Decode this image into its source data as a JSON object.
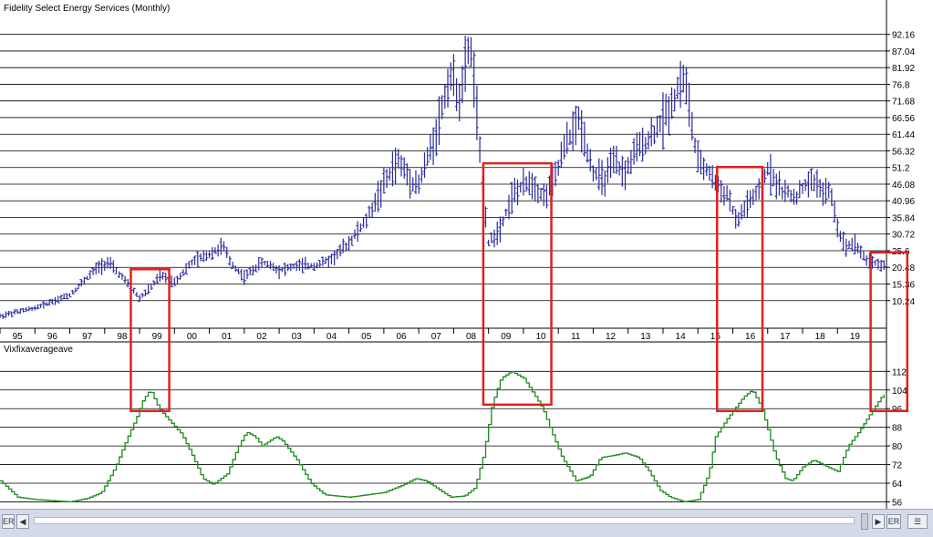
{
  "chart_data": [
    {
      "type": "ohlc",
      "title": "Fidelity Select Energy Services (Monthly)",
      "ylim": [
        4,
        96
      ],
      "y_ticks": [
        "92.16",
        "87.04",
        "81.92",
        "76.8",
        "71.68",
        "66.56",
        "61.44",
        "56.32",
        "51.2",
        "46.08",
        "40.96",
        "35.84",
        "30.72",
        "25.6",
        "20.48",
        "15.36",
        "10.24"
      ],
      "x_ticks": [
        "95",
        "96",
        "97",
        "98",
        "99",
        "00",
        "01",
        "02",
        "03",
        "04",
        "05",
        "06",
        "07",
        "08",
        "09",
        "10",
        "11",
        "12",
        "13",
        "14",
        "15",
        "16",
        "17",
        "18",
        "19"
      ],
      "x_range": [
        1995.0,
        2020.3
      ],
      "color": "#2b2a9c",
      "anchors": [
        [
          1995.0,
          5.5
        ],
        [
          1996.0,
          8.0
        ],
        [
          1997.0,
          12.0
        ],
        [
          1997.8,
          20.5
        ],
        [
          1998.1,
          22.0
        ],
        [
          1998.5,
          17.5
        ],
        [
          1999.0,
          11.0
        ],
        [
          1999.3,
          14.0
        ],
        [
          1999.6,
          18.0
        ],
        [
          2000.0,
          16.0
        ],
        [
          2000.5,
          22.0
        ],
        [
          2001.0,
          24.5
        ],
        [
          2001.4,
          27.0
        ],
        [
          2001.6,
          22.0
        ],
        [
          2002.0,
          17.5
        ],
        [
          2002.5,
          22.0
        ],
        [
          2002.8,
          21.0
        ],
        [
          2003.0,
          19.5
        ],
        [
          2003.5,
          21.0
        ],
        [
          2004.0,
          21.0
        ],
        [
          2004.5,
          23.0
        ],
        [
          2005.0,
          28.0
        ],
        [
          2005.5,
          35.0
        ],
        [
          2006.0,
          46.0
        ],
        [
          2006.4,
          53.5
        ],
        [
          2006.8,
          47.0
        ],
        [
          2007.0,
          46.0
        ],
        [
          2007.5,
          62.0
        ],
        [
          2007.9,
          80.0
        ],
        [
          2008.2,
          72.0
        ],
        [
          2008.45,
          90.0
        ],
        [
          2008.6,
          78.0
        ],
        [
          2008.75,
          55.0
        ],
        [
          2009.0,
          28.0
        ],
        [
          2009.3,
          32.0
        ],
        [
          2009.7,
          43.0
        ],
        [
          2010.2,
          47.0
        ],
        [
          2010.6,
          42.0
        ],
        [
          2010.9,
          48.0
        ],
        [
          2011.2,
          58.0
        ],
        [
          2011.6,
          66.0
        ],
        [
          2011.8,
          58.0
        ],
        [
          2012.0,
          50.0
        ],
        [
          2012.3,
          47.0
        ],
        [
          2012.6,
          53.0
        ],
        [
          2012.9,
          49.0
        ],
        [
          2013.2,
          56.0
        ],
        [
          2013.6,
          60.0
        ],
        [
          2014.0,
          66.0
        ],
        [
          2014.3,
          72.0
        ],
        [
          2014.55,
          79.0
        ],
        [
          2014.7,
          75.0
        ],
        [
          2014.85,
          62.0
        ],
        [
          2015.0,
          53.0
        ],
        [
          2015.3,
          50.0
        ],
        [
          2015.6,
          45.0
        ],
        [
          2015.9,
          42.0
        ],
        [
          2016.1,
          34.0
        ],
        [
          2016.4,
          40.0
        ],
        [
          2016.8,
          44.0
        ],
        [
          2017.0,
          51.0
        ],
        [
          2017.4,
          44.0
        ],
        [
          2017.8,
          42.0
        ],
        [
          2018.1,
          46.0
        ],
        [
          2018.4,
          47.0
        ],
        [
          2018.6,
          43.0
        ],
        [
          2018.8,
          44.0
        ],
        [
          2019.0,
          33.0
        ],
        [
          2019.2,
          27.0
        ],
        [
          2019.5,
          28.0
        ],
        [
          2019.8,
          23.0
        ],
        [
          2020.3,
          21.0
        ]
      ]
    },
    {
      "type": "line",
      "title": "Vixfixaverageave",
      "ylim": [
        55,
        118
      ],
      "y_ticks": [
        "112",
        "104",
        "96",
        "88",
        "80",
        "72",
        "64",
        "56"
      ],
      "x_range": [
        1995.0,
        2020.3
      ],
      "color": "#1e8a1e",
      "anchors": [
        [
          1995.0,
          65.0
        ],
        [
          1995.5,
          58.0
        ],
        [
          1996.0,
          57.0
        ],
        [
          1996.5,
          56.5
        ],
        [
          1997.0,
          56.0
        ],
        [
          1997.5,
          57.5
        ],
        [
          1997.9,
          60.0
        ],
        [
          1998.3,
          71.0
        ],
        [
          1998.6,
          82.0
        ],
        [
          1998.9,
          92.0
        ],
        [
          1999.1,
          100.0
        ],
        [
          1999.3,
          104.0
        ],
        [
          1999.55,
          96.0
        ],
        [
          1999.9,
          90.0
        ],
        [
          2000.2,
          85.0
        ],
        [
          2000.5,
          76.0
        ],
        [
          2000.8,
          66.0
        ],
        [
          2001.1,
          63.5
        ],
        [
          2001.5,
          68.0
        ],
        [
          2001.8,
          79.0
        ],
        [
          2002.05,
          86.0
        ],
        [
          2002.3,
          84.0
        ],
        [
          2002.5,
          80.0
        ],
        [
          2002.9,
          84.0
        ],
        [
          2003.1,
          82.0
        ],
        [
          2003.5,
          74.0
        ],
        [
          2003.9,
          64.0
        ],
        [
          2004.3,
          59.0
        ],
        [
          2005.0,
          58.0
        ],
        [
          2005.5,
          59.0
        ],
        [
          2006.0,
          60.0
        ],
        [
          2006.5,
          63.0
        ],
        [
          2006.9,
          66.0
        ],
        [
          2007.2,
          65.0
        ],
        [
          2007.5,
          62.0
        ],
        [
          2007.9,
          58.0
        ],
        [
          2008.3,
          58.5
        ],
        [
          2008.6,
          62.0
        ],
        [
          2008.85,
          76.0
        ],
        [
          2009.1,
          98.0
        ],
        [
          2009.35,
          109.0
        ],
        [
          2009.65,
          112.0
        ],
        [
          2010.0,
          109.0
        ],
        [
          2010.3,
          102.0
        ],
        [
          2010.55,
          96.0
        ],
        [
          2010.8,
          86.0
        ],
        [
          2011.1,
          75.0
        ],
        [
          2011.5,
          65.0
        ],
        [
          2011.9,
          67.0
        ],
        [
          2012.2,
          75.0
        ],
        [
          2012.6,
          76.0
        ],
        [
          2012.9,
          77.0
        ],
        [
          2013.3,
          75.0
        ],
        [
          2013.6,
          69.0
        ],
        [
          2013.9,
          61.0
        ],
        [
          2014.2,
          58.0
        ],
        [
          2014.6,
          56.0
        ],
        [
          2015.0,
          57.0
        ],
        [
          2015.3,
          68.0
        ],
        [
          2015.5,
          84.0
        ],
        [
          2015.8,
          91.0
        ],
        [
          2016.0,
          95.0
        ],
        [
          2016.3,
          101.0
        ],
        [
          2016.55,
          104.0
        ],
        [
          2016.8,
          97.0
        ],
        [
          2017.0,
          87.0
        ],
        [
          2017.2,
          76.0
        ],
        [
          2017.5,
          66.0
        ],
        [
          2017.7,
          65.0
        ],
        [
          2018.0,
          71.0
        ],
        [
          2018.3,
          74.0
        ],
        [
          2018.7,
          71.0
        ],
        [
          2019.0,
          69.0
        ],
        [
          2019.3,
          80.0
        ],
        [
          2019.6,
          86.0
        ],
        [
          2019.9,
          93.0
        ],
        [
          2020.1,
          97.5
        ],
        [
          2020.3,
          102.0
        ]
      ]
    }
  ],
  "highlight_boxes": [
    {
      "x_from": 1998.75,
      "x_to": 1999.85
    },
    {
      "x_from": 2008.85,
      "x_to": 2010.8
    },
    {
      "x_from": 2015.55,
      "x_to": 2016.85
    },
    {
      "x_from": 2019.95,
      "x_to": 2021.0
    }
  ],
  "scrollbar": {
    "left_label": "ER",
    "right_label": "ER"
  },
  "colors": {
    "grid": "#000000",
    "highlight": "#e02020",
    "background": "#ffffff"
  }
}
